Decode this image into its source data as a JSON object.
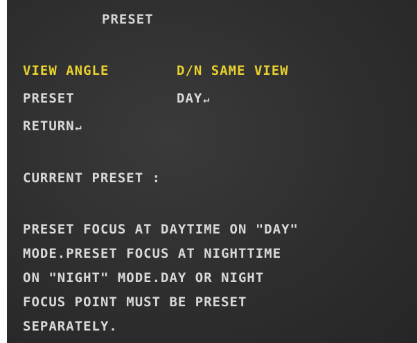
{
  "osd": {
    "title": "PRESET",
    "menu": [
      {
        "label": "VIEW ANGLE",
        "value": "D/N SAME VIEW",
        "selected": true
      },
      {
        "label": "PRESET",
        "value": "DAY",
        "value_enter_glyph": "↵",
        "selected": false
      },
      {
        "label": "RETURN",
        "label_enter_glyph": "↵",
        "selected": false
      }
    ],
    "current_preset_label": "CURRENT PRESET :",
    "description_lines": [
      "PRESET FOCUS AT DAYTIME ON \"DAY\"",
      "MODE.PRESET FOCUS AT NIGHTTIME",
      "ON \"NIGHT\" MODE.DAY OR NIGHT",
      "FOCUS POINT MUST BE PRESET",
      "SEPARATELY."
    ],
    "colors": {
      "background": "#2e2e2e",
      "text": "#d9d9d9",
      "highlight": "#e9d12e"
    },
    "icons": {
      "enter": "enter-arrow-icon"
    }
  }
}
